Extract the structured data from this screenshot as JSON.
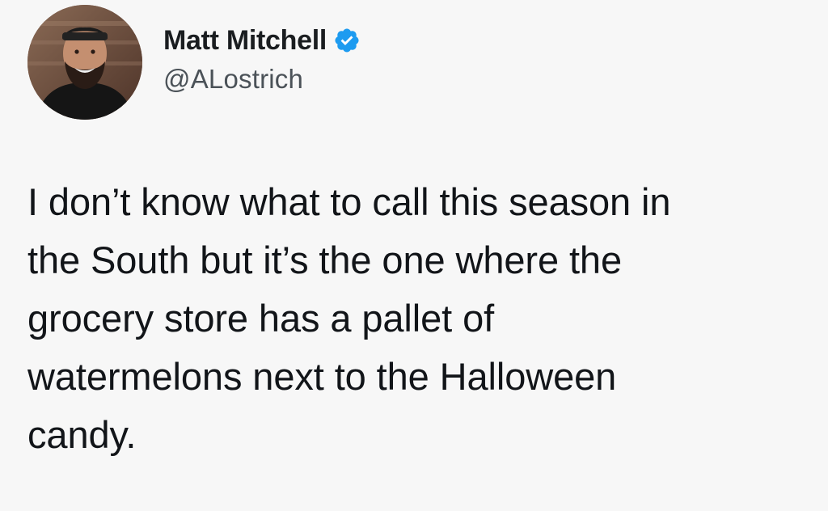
{
  "author": {
    "display_name": "Matt Mitchell",
    "handle": "@ALostrich",
    "verified": true,
    "avatar_icon": "profile-photo",
    "verified_icon": "verified-badge-icon"
  },
  "tweet": {
    "text": "I don’t know what to call this season in\nthe South but it’s the one where the\ngrocery store has a pallet of\nwatermelons next to the Halloween\ncandy."
  },
  "colors": {
    "background": "#f7f7f7",
    "text": "#16191c",
    "handle": "#4b5258",
    "verified_blue": "#1d9bf0"
  }
}
